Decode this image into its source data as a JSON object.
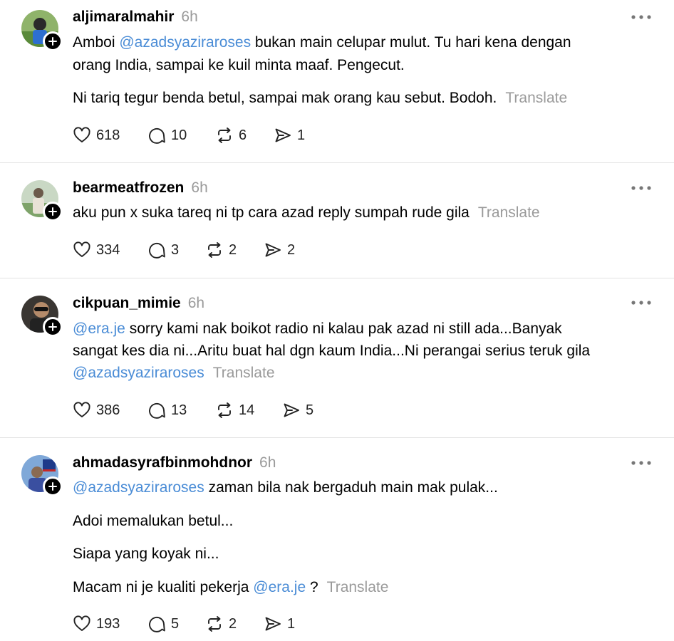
{
  "posts": [
    {
      "username": "aljimaralmahir",
      "time": "6h",
      "paragraphs": [
        [
          "Amboi ",
          "@azadsyaziraroses",
          " bukan main celupar mulut. Tu hari kena dengan"
        ],
        [
          "orang India, sampai ke kuil minta maaf. Pengecut."
        ],
        [
          "Ni tariq tegur benda betul, sampai mak orang kau sebut. Bodoh."
        ]
      ],
      "translate": "Translate",
      "likes": "618",
      "replies": "10",
      "reposts": "6",
      "shares": "1"
    },
    {
      "username": "bearmeatfrozen",
      "time": "6h",
      "paragraphs": [
        [
          "aku pun x suka tareq ni tp cara azad reply sumpah rude gila"
        ]
      ],
      "translate": "Translate",
      "likes": "334",
      "replies": "3",
      "reposts": "2",
      "shares": "2"
    },
    {
      "username": "cikpuan_mimie",
      "time": "6h",
      "paragraphs": [
        [
          "@era.je",
          " sorry kami nak boikot radio ni kalau pak azad ni still ada...Banyak"
        ],
        [
          "sangat kes dia ni...Aritu buat hal dgn kaum India...Ni perangai serius teruk gila"
        ],
        [
          "@azadsyaziraroses"
        ]
      ],
      "translate": "Translate",
      "likes": "386",
      "replies": "13",
      "reposts": "14",
      "shares": "5"
    },
    {
      "username": "ahmadasyrafbinmohdnor",
      "time": "6h",
      "paragraphs": [
        [
          "@azadsyaziraroses",
          " zaman bila nak bergaduh main mak pulak..."
        ],
        [
          "Adoi memalukan betul..."
        ],
        [
          "Siapa yang koyak ni..."
        ],
        [
          "Macam ni je kualiti pekerja ",
          "@era.je",
          " ?"
        ]
      ],
      "translate": "Translate",
      "likes": "193",
      "replies": "5",
      "reposts": "2",
      "shares": "1"
    }
  ]
}
